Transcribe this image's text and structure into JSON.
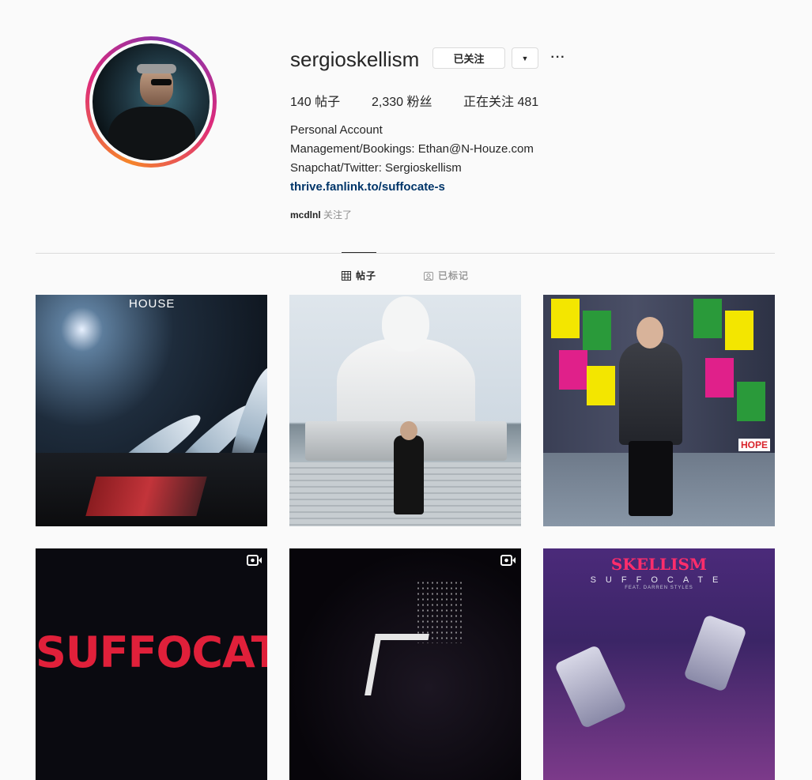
{
  "profile": {
    "username": "sergioskellism",
    "follow_button": "已关注",
    "dropdown_icon": "▼",
    "more_icon": "···"
  },
  "stats": {
    "posts": "140 帖子",
    "followers": "2,330 粉丝",
    "following": "正在关注 481"
  },
  "bio": {
    "line1": "Personal Account",
    "line2": "Management/Bookings: Ethan@N-Houze.com",
    "line3": "Snapchat/Twitter: Sergioskellism",
    "link": "thrive.fanlink.to/suffocate-s",
    "followed_by_user": "mcdlnl",
    "followed_by_suffix": "关注了"
  },
  "tabs": {
    "posts": "帖子",
    "tagged": "已标记"
  },
  "posts": [
    {
      "label": "HOUSE"
    },
    {
      "label": ""
    },
    {
      "label": "HOPE"
    },
    {
      "label": "SUFFOCATE"
    },
    {
      "label": ""
    },
    {
      "title": "SKELLISM",
      "subtitle": "SUFFOCATE",
      "feat": "FEAT. DARREN STYLES"
    }
  ]
}
